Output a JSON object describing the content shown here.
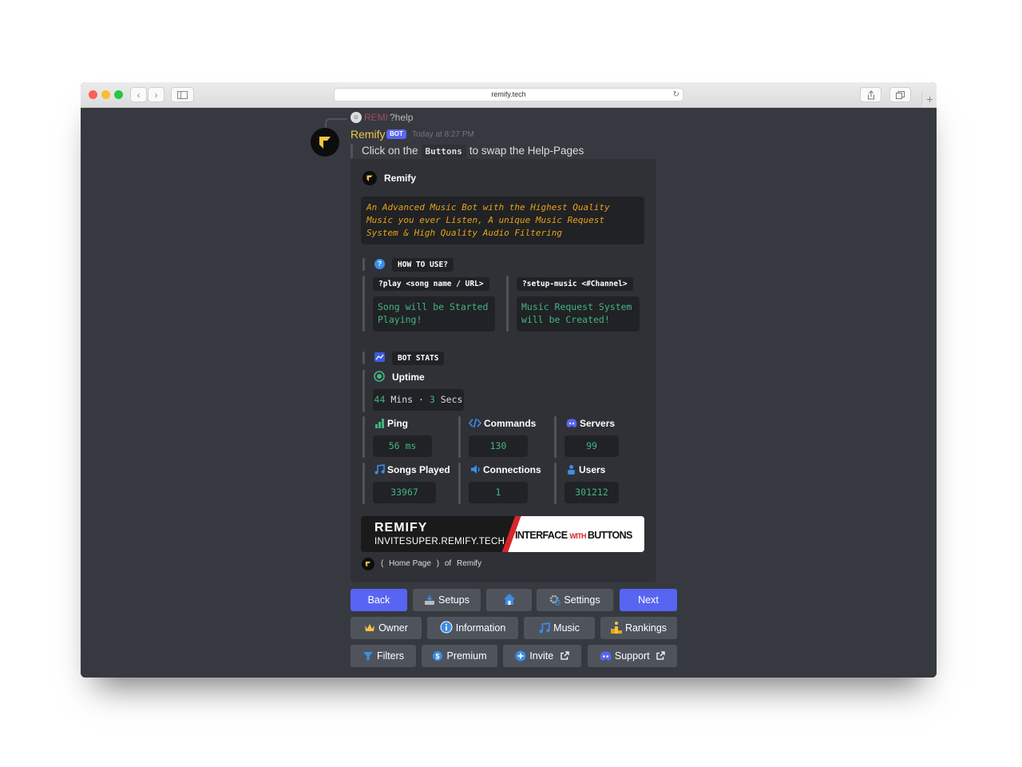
{
  "browser": {
    "url": "remify.tech",
    "nav_back": "‹",
    "nav_forward": "›",
    "new_tab": "+"
  },
  "reply": {
    "name": "REMI",
    "command": "?help"
  },
  "message": {
    "author": "Remify",
    "bot_tag": "BOT",
    "timestamp": "Today at 8:27 PM",
    "text_before": "Click on the",
    "code": "Buttons",
    "text_after": "to swap the Help-Pages"
  },
  "embed": {
    "author": "Remify",
    "description": "An Advanced Music Bot with the Highest Quality\nMusic you ever Listen, A unique Music Request\nSystem & High Quality Audio Filtering",
    "how_to_use": {
      "title": "HOW TO USE?",
      "commands": [
        {
          "command": "?play <song name / URL>",
          "result": "Song will be Started\nPlaying!"
        },
        {
          "command": "?setup-music <#Channel>",
          "result": "Music Request System\nwill be Created!"
        }
      ]
    },
    "bot_stats": {
      "title": "BOT STATS",
      "uptime_label": "Uptime",
      "uptime": {
        "mins": "44",
        "mins_unit": "Mins",
        "sep": "·",
        "secs": "3",
        "secs_unit": "Secs"
      },
      "stats": [
        {
          "label": "Ping",
          "value": "56 ms",
          "icon": "signal-bars-icon"
        },
        {
          "label": "Commands",
          "value": "130",
          "icon": "code-icon"
        },
        {
          "label": "Servers",
          "value": "99",
          "icon": "discord-icon"
        },
        {
          "label": "Songs Played",
          "value": "33967",
          "icon": "music-note-icon"
        },
        {
          "label": "Connections",
          "value": "1",
          "icon": "speaker-icon"
        },
        {
          "label": "Users",
          "value": "301212",
          "icon": "users-icon"
        }
      ]
    },
    "banner": {
      "title": "REMIFY",
      "subtitle": "INVITESUPER.REMIFY.TECH",
      "tagline_a": "INTERFACE ",
      "tagline_b": "WITH ",
      "tagline_c": "BUTTONS"
    },
    "footer": {
      "open": "(",
      "page": "Home Page",
      "close": ")",
      "of": "of",
      "bot": "Remify"
    }
  },
  "buttons": {
    "row1": [
      "Back",
      "Setups",
      "",
      "Settings",
      "Next"
    ],
    "row2": [
      "Owner",
      "Information",
      "Music",
      "Rankings"
    ],
    "row3": [
      "Filters",
      "Premium",
      "Invite",
      "Support"
    ]
  },
  "colors": {
    "background": "#36393f",
    "embed": "#2f3136",
    "code_bg": "#202225",
    "blurple": "#5865f2",
    "secondary_button": "#4f545c",
    "author_gold": "#f5c542",
    "green_code": "#43b581",
    "desc_orange": "#e8a317"
  }
}
